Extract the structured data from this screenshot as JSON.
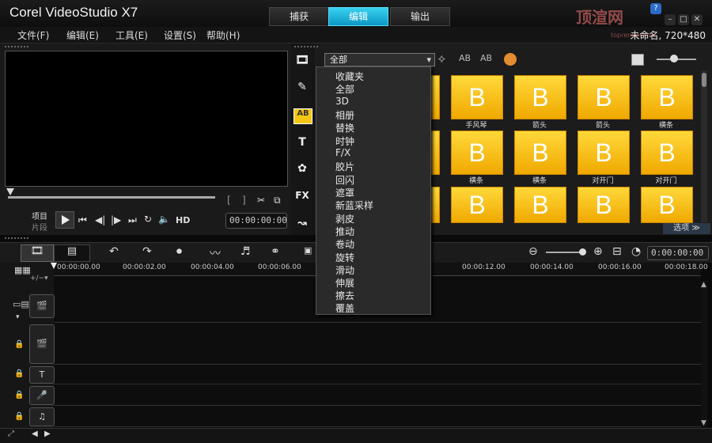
{
  "window": {
    "title": "Corel VideoStudio X7",
    "project_info": "未命名, 720*480",
    "watermark": "顶渲网",
    "watermark_sub": "toprender.com",
    "help_btn": "?",
    "min_btn": "–",
    "max_btn": "□",
    "close_btn": "✕"
  },
  "mode_tabs": [
    {
      "label": "捕获",
      "active": false
    },
    {
      "label": "编辑",
      "active": true
    },
    {
      "label": "输出",
      "active": false
    }
  ],
  "menu": [
    "文件(F)",
    "编辑(E)",
    "工具(E)",
    "设置(S)",
    "帮助(H)"
  ],
  "player": {
    "project_label": "项目",
    "clip_label": "片段",
    "hd_label": "HD",
    "timecode": "00:00:00:00"
  },
  "library": {
    "filter_selected": "全部",
    "dropdown_items": [
      "收藏夹",
      "全部",
      "3D",
      "相册",
      "替换",
      "时钟",
      "F/X",
      "胶片",
      "回闪",
      "遮罩",
      "新蓝采样",
      "剥皮",
      "推动",
      "卷动",
      "旋转",
      "滑动",
      "伸展",
      "擦去",
      "覆盖"
    ],
    "thumb_glyph": "B",
    "row1_labels": [
      "手风琴",
      "箭头",
      "箭头",
      "横条"
    ],
    "row2_labels": [
      "横条",
      "横条",
      "对开门",
      "对开门"
    ],
    "options_label": "选项 ≫"
  },
  "timeline": {
    "time_display": "0:00:00:00",
    "ruler_ticks": [
      "00:00:00.00",
      "00:00:02.00",
      "00:00:04.00",
      "00:00:06.00",
      "00:00:12.00",
      "00:00:14.00",
      "00:00:16.00",
      "00:00:18.00"
    ]
  },
  "colors": {
    "accent_tab": "#1aa8d8",
    "thumb_yellow": "#ffd93a"
  }
}
